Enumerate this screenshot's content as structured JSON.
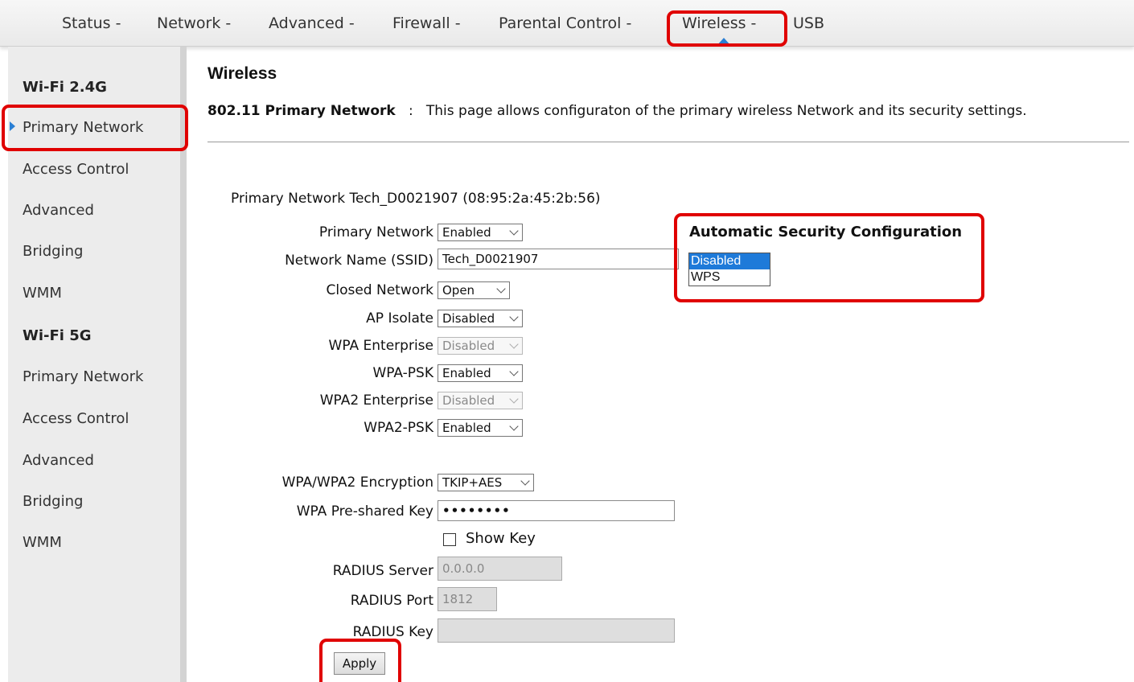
{
  "topnav": {
    "items": [
      "Status -",
      "Network -",
      "Advanced -",
      "Firewall -",
      "Parental Control -",
      "Wireless -",
      "USB"
    ],
    "active_index": 5,
    "accent_color": "#2a7fd4"
  },
  "sidebar": {
    "groups": [
      {
        "heading": "Wi-Fi 2.4G",
        "items": [
          "Primary Network",
          "Access Control",
          "Advanced",
          "Bridging",
          "WMM"
        ]
      },
      {
        "heading": "Wi-Fi 5G",
        "items": [
          "Primary Network",
          "Access Control",
          "Advanced",
          "Bridging",
          "WMM"
        ]
      }
    ],
    "active_item": "Primary Network"
  },
  "main": {
    "title": "Wireless",
    "description_label": "802.11 Primary Network",
    "description_sep": ":",
    "description_text": "This page allows configuraton of the primary wireless Network and its security settings.",
    "network_heading": "Primary Network Tech_D0021907 (08:95:2a:45:2b:56)"
  },
  "form": {
    "primary_network": {
      "label": "Primary Network",
      "value": "Enabled"
    },
    "ssid": {
      "label": "Network Name (SSID)",
      "value": "Tech_D0021907"
    },
    "closed_network": {
      "label": "Closed Network",
      "value": "Open"
    },
    "ap_isolate": {
      "label": "AP Isolate",
      "value": "Disabled"
    },
    "wpa_enterprise": {
      "label": "WPA Enterprise",
      "value": "Disabled"
    },
    "wpa_psk": {
      "label": "WPA-PSK",
      "value": "Enabled"
    },
    "wpa2_enterprise": {
      "label": "WPA2 Enterprise",
      "value": "Disabled"
    },
    "wpa2_psk": {
      "label": "WPA2-PSK",
      "value": "Enabled"
    },
    "encryption": {
      "label": "WPA/WPA2 Encryption",
      "value": "TKIP+AES"
    },
    "psk": {
      "label": "WPA Pre-shared Key",
      "value": "••••••••"
    },
    "show_key": {
      "label": "Show Key",
      "checked": false
    },
    "radius_server": {
      "label": "RADIUS Server",
      "value": "0.0.0.0"
    },
    "radius_port": {
      "label": "RADIUS Port",
      "value": "1812"
    },
    "radius_key": {
      "label": "RADIUS Key",
      "value": ""
    },
    "apply_label": "Apply"
  },
  "auto_security": {
    "title": "Automatic Security Configuration",
    "options": [
      "Disabled",
      "WPS"
    ],
    "selected": "Disabled"
  },
  "colors": {
    "highlight": "#e00000",
    "selection": "#1e7ad9"
  }
}
